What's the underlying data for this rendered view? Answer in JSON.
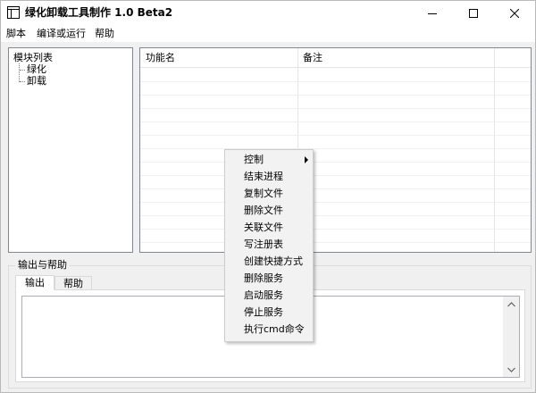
{
  "window": {
    "title": "绿化卸载工具制作 1.0 Beta2",
    "app_icon": "window-icon",
    "controls": {
      "minimize": "minimize-icon",
      "maximize": "maximize-icon",
      "close": "close-icon"
    }
  },
  "menubar": {
    "items": [
      {
        "label": "脚本"
      },
      {
        "label": "编译或运行"
      },
      {
        "label": "帮助"
      }
    ]
  },
  "tree": {
    "root": "模块列表",
    "children": [
      {
        "label": "绿化"
      },
      {
        "label": "卸载"
      }
    ]
  },
  "grid": {
    "columns": [
      {
        "label": "功能名"
      },
      {
        "label": "备注"
      }
    ],
    "rows": []
  },
  "output_group": {
    "label": "输出与帮助",
    "tabs": [
      {
        "label": "输出",
        "active": true
      },
      {
        "label": "帮助",
        "active": false
      }
    ],
    "output_text": ""
  },
  "context_menu": {
    "items": [
      {
        "label": "控制",
        "has_submenu": true
      },
      {
        "label": "结束进程"
      },
      {
        "label": "复制文件"
      },
      {
        "label": "删除文件"
      },
      {
        "label": "关联文件"
      },
      {
        "label": "写注册表"
      },
      {
        "label": "创建快捷方式"
      },
      {
        "label": "删除服务"
      },
      {
        "label": "启动服务"
      },
      {
        "label": "停止服务"
      },
      {
        "label": "执行cmd命令"
      }
    ]
  }
}
